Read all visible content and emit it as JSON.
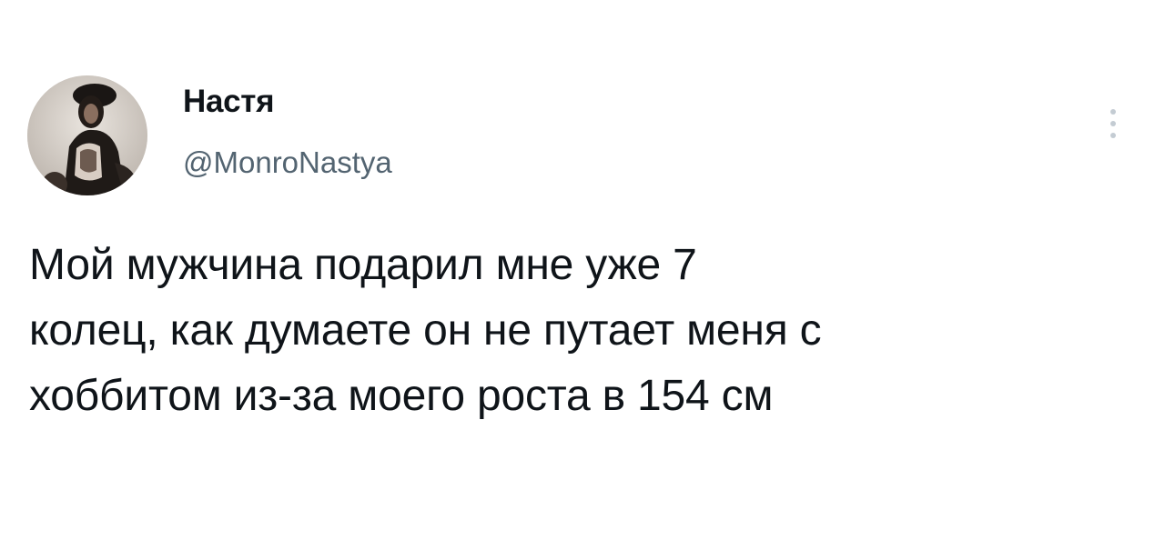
{
  "tweet": {
    "author": {
      "display_name": "Настя",
      "handle": "@MonroNastya",
      "avatar_icon": "user-avatar-photo"
    },
    "text": "Мой мужчина подарил мне уже 7\nколец, как думаете он не путает меня с\nхоббитом из-за моего роста в 154 см",
    "more_icon": "more-options-vertical-dots-icon"
  },
  "colors": {
    "text_primary": "#0f1419",
    "text_secondary": "#536471",
    "icon_muted": "#c4ccd3",
    "background": "#ffffff"
  }
}
